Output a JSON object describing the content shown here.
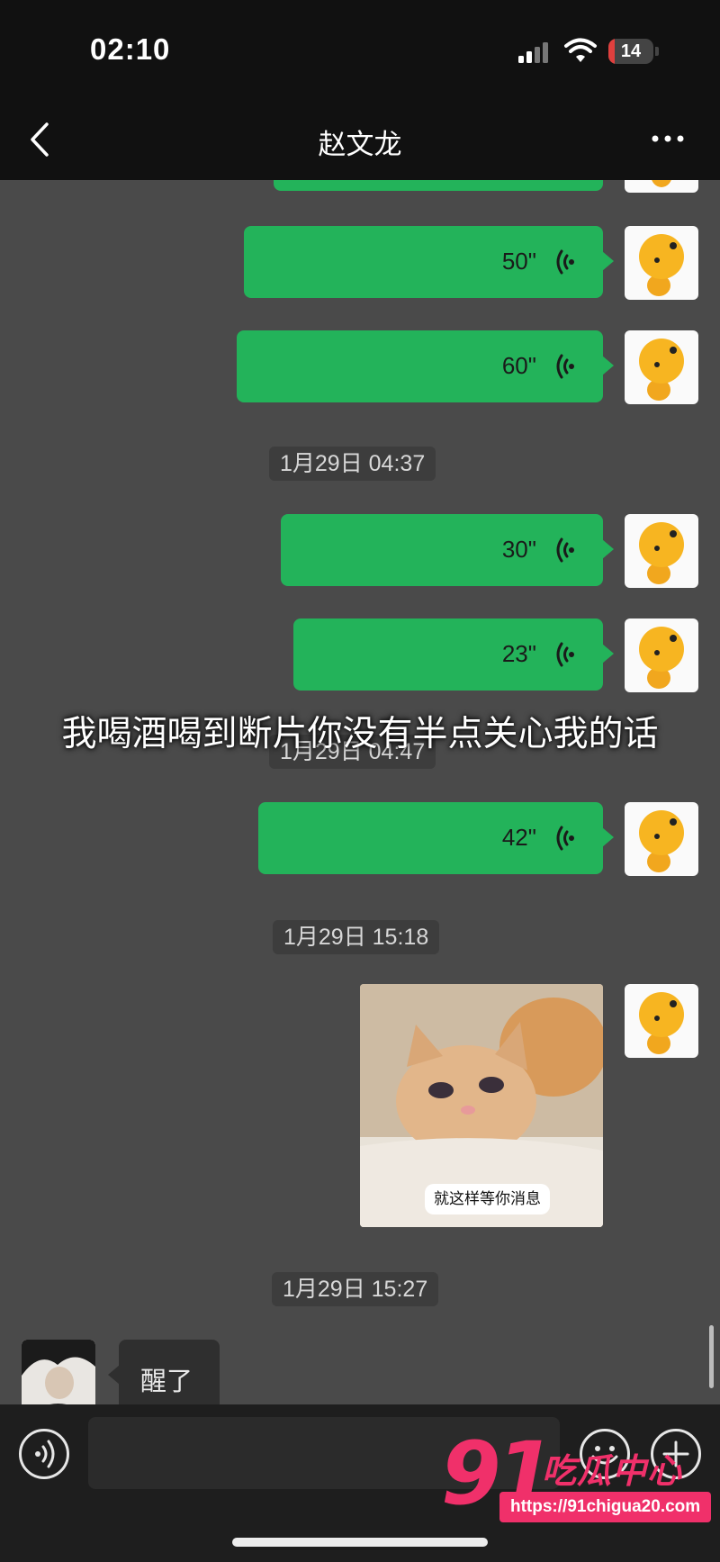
{
  "status_bar": {
    "time": "02:10",
    "battery": "14",
    "battery_level": 0.14
  },
  "header": {
    "title": "赵文龙"
  },
  "messages": {
    "voice_1": "50\"",
    "voice_2": "60\"",
    "timestamp_1": "1月29日 04:37",
    "voice_3": "30\"",
    "voice_4": "23\"",
    "timestamp_2": "1月29日 04:47",
    "voice_5": "42\"",
    "timestamp_3": "1月29日 15:18",
    "image_caption": "就这样等你消息",
    "timestamp_4": "1月29日 15:27",
    "incoming_text": "醒了"
  },
  "overlay_caption": "我喝酒喝到断片你没有半点关心我的话",
  "input": {
    "value": ""
  },
  "watermark": {
    "logo": "91",
    "brand": "吃瓜中心",
    "url": "https://91chigua20.com"
  },
  "colors": {
    "outgoing_bubble": "#23b35a",
    "chat_background": "#4a4a4a",
    "watermark": "#f0306a"
  },
  "icons": [
    "back-icon",
    "more-icon",
    "voice-play-icon",
    "voice-input-icon",
    "emoji-icon",
    "plus-icon",
    "signal-icon",
    "wifi-icon",
    "battery-icon"
  ]
}
